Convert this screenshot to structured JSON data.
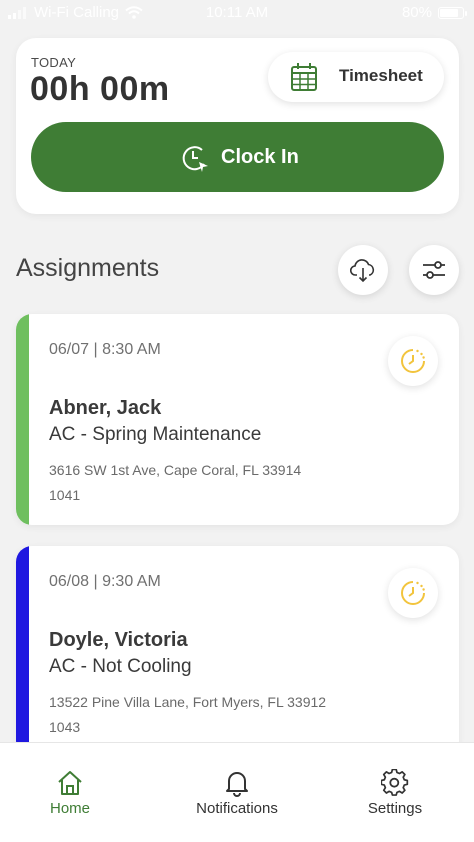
{
  "status_bar": {
    "carrier": "Wi-Fi Calling",
    "time": "10:11 AM",
    "battery": "80%"
  },
  "today": {
    "label": "TODAY",
    "elapsed": "00h 00m",
    "timesheet_label": "Timesheet",
    "clock_in_label": "Clock In"
  },
  "assignments": {
    "title": "Assignments",
    "items": [
      {
        "datetime": "06/07 | 8:30 AM",
        "customer": "Abner, Jack",
        "service": "AC - Spring Maintenance",
        "address": "3616 SW 1st Ave, Cape Coral, FL  33914",
        "job_number": "1041",
        "accent_color": "#6fbf5f"
      },
      {
        "datetime": "06/08 | 9:30 AM",
        "customer": "Doyle, Victoria",
        "service": "AC - Not Cooling",
        "address": "13522 Pine Villa Lane, Fort Myers, FL  33912",
        "job_number": "1043",
        "accent_color": "#1f18e0"
      }
    ]
  },
  "tab_bar": {
    "home": "Home",
    "notifications": "Notifications",
    "settings": "Settings"
  },
  "colors": {
    "primary_green": "#3f7d35",
    "timer_yellow": "#f2c43d",
    "background": "#f2f2f2"
  },
  "icons": {
    "timesheet": "calendar-icon",
    "clock_in": "clock-icon",
    "download": "cloud-download-icon",
    "filter": "sliders-icon",
    "timer": "timer-icon",
    "home": "home-icon",
    "notifications": "bell-icon",
    "settings": "gear-icon"
  }
}
